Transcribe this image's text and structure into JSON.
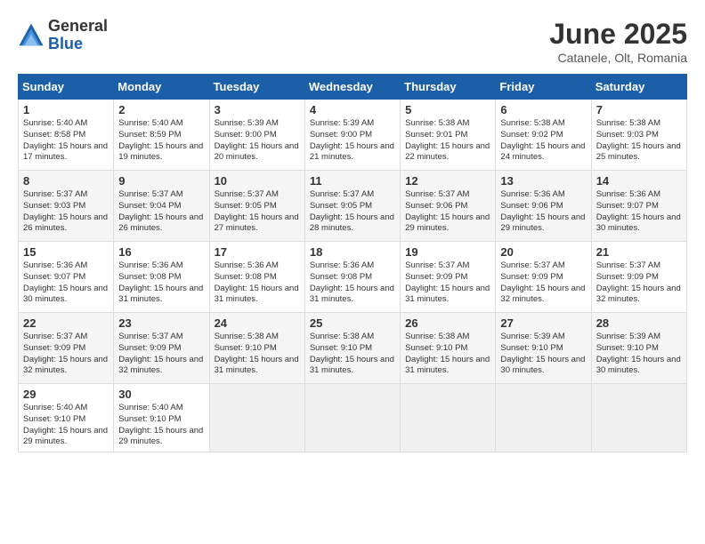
{
  "header": {
    "logo_general": "General",
    "logo_blue": "Blue",
    "month_title": "June 2025",
    "location": "Catanele, Olt, Romania"
  },
  "days_of_week": [
    "Sunday",
    "Monday",
    "Tuesday",
    "Wednesday",
    "Thursday",
    "Friday",
    "Saturday"
  ],
  "weeks": [
    [
      {
        "day": "1",
        "sunrise": "Sunrise: 5:40 AM",
        "sunset": "Sunset: 8:58 PM",
        "daylight": "Daylight: 15 hours and 17 minutes."
      },
      {
        "day": "2",
        "sunrise": "Sunrise: 5:40 AM",
        "sunset": "Sunset: 8:59 PM",
        "daylight": "Daylight: 15 hours and 19 minutes."
      },
      {
        "day": "3",
        "sunrise": "Sunrise: 5:39 AM",
        "sunset": "Sunset: 9:00 PM",
        "daylight": "Daylight: 15 hours and 20 minutes."
      },
      {
        "day": "4",
        "sunrise": "Sunrise: 5:39 AM",
        "sunset": "Sunset: 9:00 PM",
        "daylight": "Daylight: 15 hours and 21 minutes."
      },
      {
        "day": "5",
        "sunrise": "Sunrise: 5:38 AM",
        "sunset": "Sunset: 9:01 PM",
        "daylight": "Daylight: 15 hours and 22 minutes."
      },
      {
        "day": "6",
        "sunrise": "Sunrise: 5:38 AM",
        "sunset": "Sunset: 9:02 PM",
        "daylight": "Daylight: 15 hours and 24 minutes."
      },
      {
        "day": "7",
        "sunrise": "Sunrise: 5:38 AM",
        "sunset": "Sunset: 9:03 PM",
        "daylight": "Daylight: 15 hours and 25 minutes."
      }
    ],
    [
      {
        "day": "8",
        "sunrise": "Sunrise: 5:37 AM",
        "sunset": "Sunset: 9:03 PM",
        "daylight": "Daylight: 15 hours and 26 minutes."
      },
      {
        "day": "9",
        "sunrise": "Sunrise: 5:37 AM",
        "sunset": "Sunset: 9:04 PM",
        "daylight": "Daylight: 15 hours and 26 minutes."
      },
      {
        "day": "10",
        "sunrise": "Sunrise: 5:37 AM",
        "sunset": "Sunset: 9:05 PM",
        "daylight": "Daylight: 15 hours and 27 minutes."
      },
      {
        "day": "11",
        "sunrise": "Sunrise: 5:37 AM",
        "sunset": "Sunset: 9:05 PM",
        "daylight": "Daylight: 15 hours and 28 minutes."
      },
      {
        "day": "12",
        "sunrise": "Sunrise: 5:37 AM",
        "sunset": "Sunset: 9:06 PM",
        "daylight": "Daylight: 15 hours and 29 minutes."
      },
      {
        "day": "13",
        "sunrise": "Sunrise: 5:36 AM",
        "sunset": "Sunset: 9:06 PM",
        "daylight": "Daylight: 15 hours and 29 minutes."
      },
      {
        "day": "14",
        "sunrise": "Sunrise: 5:36 AM",
        "sunset": "Sunset: 9:07 PM",
        "daylight": "Daylight: 15 hours and 30 minutes."
      }
    ],
    [
      {
        "day": "15",
        "sunrise": "Sunrise: 5:36 AM",
        "sunset": "Sunset: 9:07 PM",
        "daylight": "Daylight: 15 hours and 30 minutes."
      },
      {
        "day": "16",
        "sunrise": "Sunrise: 5:36 AM",
        "sunset": "Sunset: 9:08 PM",
        "daylight": "Daylight: 15 hours and 31 minutes."
      },
      {
        "day": "17",
        "sunrise": "Sunrise: 5:36 AM",
        "sunset": "Sunset: 9:08 PM",
        "daylight": "Daylight: 15 hours and 31 minutes."
      },
      {
        "day": "18",
        "sunrise": "Sunrise: 5:36 AM",
        "sunset": "Sunset: 9:08 PM",
        "daylight": "Daylight: 15 hours and 31 minutes."
      },
      {
        "day": "19",
        "sunrise": "Sunrise: 5:37 AM",
        "sunset": "Sunset: 9:09 PM",
        "daylight": "Daylight: 15 hours and 31 minutes."
      },
      {
        "day": "20",
        "sunrise": "Sunrise: 5:37 AM",
        "sunset": "Sunset: 9:09 PM",
        "daylight": "Daylight: 15 hours and 32 minutes."
      },
      {
        "day": "21",
        "sunrise": "Sunrise: 5:37 AM",
        "sunset": "Sunset: 9:09 PM",
        "daylight": "Daylight: 15 hours and 32 minutes."
      }
    ],
    [
      {
        "day": "22",
        "sunrise": "Sunrise: 5:37 AM",
        "sunset": "Sunset: 9:09 PM",
        "daylight": "Daylight: 15 hours and 32 minutes."
      },
      {
        "day": "23",
        "sunrise": "Sunrise: 5:37 AM",
        "sunset": "Sunset: 9:09 PM",
        "daylight": "Daylight: 15 hours and 32 minutes."
      },
      {
        "day": "24",
        "sunrise": "Sunrise: 5:38 AM",
        "sunset": "Sunset: 9:10 PM",
        "daylight": "Daylight: 15 hours and 31 minutes."
      },
      {
        "day": "25",
        "sunrise": "Sunrise: 5:38 AM",
        "sunset": "Sunset: 9:10 PM",
        "daylight": "Daylight: 15 hours and 31 minutes."
      },
      {
        "day": "26",
        "sunrise": "Sunrise: 5:38 AM",
        "sunset": "Sunset: 9:10 PM",
        "daylight": "Daylight: 15 hours and 31 minutes."
      },
      {
        "day": "27",
        "sunrise": "Sunrise: 5:39 AM",
        "sunset": "Sunset: 9:10 PM",
        "daylight": "Daylight: 15 hours and 30 minutes."
      },
      {
        "day": "28",
        "sunrise": "Sunrise: 5:39 AM",
        "sunset": "Sunset: 9:10 PM",
        "daylight": "Daylight: 15 hours and 30 minutes."
      }
    ],
    [
      {
        "day": "29",
        "sunrise": "Sunrise: 5:40 AM",
        "sunset": "Sunset: 9:10 PM",
        "daylight": "Daylight: 15 hours and 29 minutes."
      },
      {
        "day": "30",
        "sunrise": "Sunrise: 5:40 AM",
        "sunset": "Sunset: 9:10 PM",
        "daylight": "Daylight: 15 hours and 29 minutes."
      },
      {
        "day": "",
        "sunrise": "",
        "sunset": "",
        "daylight": ""
      },
      {
        "day": "",
        "sunrise": "",
        "sunset": "",
        "daylight": ""
      },
      {
        "day": "",
        "sunrise": "",
        "sunset": "",
        "daylight": ""
      },
      {
        "day": "",
        "sunrise": "",
        "sunset": "",
        "daylight": ""
      },
      {
        "day": "",
        "sunrise": "",
        "sunset": "",
        "daylight": ""
      }
    ]
  ]
}
